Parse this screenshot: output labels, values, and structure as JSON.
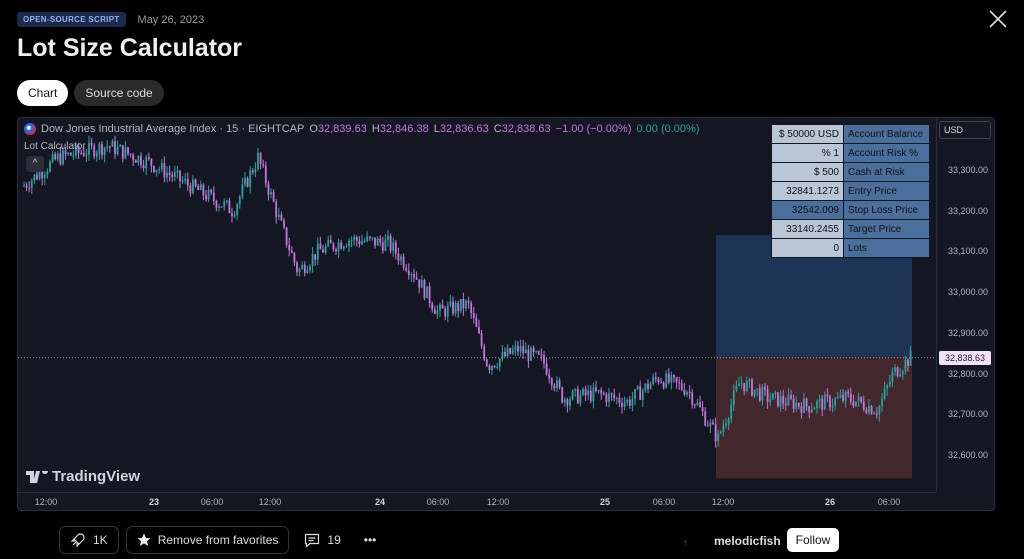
{
  "header": {
    "badge": "OPEN-SOURCE SCRIPT",
    "date": "May 26, 2023",
    "title": "Lot Size Calculator",
    "close_icon": "close-icon"
  },
  "tabs": [
    {
      "label": "Chart",
      "active": true
    },
    {
      "label": "Source code",
      "active": false
    }
  ],
  "chart": {
    "symbol": "Dow Jones Industrial Average Index · 15 · EIGHTCAP",
    "ohlc": {
      "o_label": "O",
      "o": "32,839.63",
      "h_label": "H",
      "h": "32,846.38",
      "l_label": "L",
      "l": "32,836.63",
      "c_label": "C",
      "c": "32,838.63",
      "change": "−1.00 (−0.00%)",
      "indicator_values": "0.00 (0.00%)"
    },
    "indicator_label": "Lot Calculator",
    "collapse_glyph": "^",
    "currency": "USD",
    "current_price": "32,838.63",
    "calculator": [
      {
        "value": "$ 50000 USD",
        "label": "Account Balance"
      },
      {
        "value": "% 1",
        "label": "Account Risk %"
      },
      {
        "value": "$ 500",
        "label": "Cash at Risk"
      },
      {
        "value": "32841.1273",
        "label": "Entry Price"
      },
      {
        "value": "32542.009",
        "label": "Stop Loss Price"
      },
      {
        "value": "33140.2455",
        "label": "Target Price"
      },
      {
        "value": "0",
        "label": "Lots"
      }
    ],
    "price_ticks": [
      "33,300.00",
      "33,200.00",
      "33,100.00",
      "33,000.00",
      "32,900.00",
      "32,800.00",
      "32,700.00",
      "32,600.00"
    ],
    "time_ticks": [
      {
        "label": "12:00",
        "bold": false
      },
      {
        "label": "23",
        "bold": true
      },
      {
        "label": "06:00",
        "bold": false
      },
      {
        "label": "12:00",
        "bold": false
      },
      {
        "label": "24",
        "bold": true
      },
      {
        "label": "06:00",
        "bold": false
      },
      {
        "label": "12:00",
        "bold": false
      },
      {
        "label": "25",
        "bold": true
      },
      {
        "label": "06:00",
        "bold": false
      },
      {
        "label": "12:00",
        "bold": false
      },
      {
        "label": "26",
        "bold": true
      },
      {
        "label": "06:00",
        "bold": false
      }
    ],
    "brand": "TradingView",
    "colors": {
      "up": "#26a69a",
      "down": "#c774e0",
      "profit_zone": "#1f3a5f",
      "loss_zone": "#4a2a2e"
    }
  },
  "actions": {
    "boosts": "1K",
    "favorite_label": "Remove from favorites",
    "comments": "19",
    "more_glyph": "•••",
    "author": "melodicfish",
    "follow_label": "Follow",
    "tiny_mark": "↑"
  }
}
